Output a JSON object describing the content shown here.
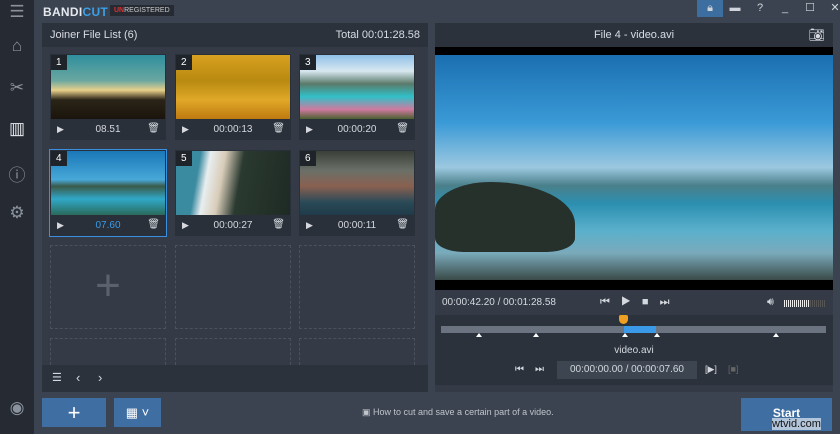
{
  "app": {
    "logo_main": "BANDI",
    "logo_accent": "CUT",
    "unreg_red": "UN",
    "unreg_rest": "REGISTERED",
    "watermark": "wtvid.com"
  },
  "sidebar": {
    "items": [
      "menu",
      "home",
      "cut",
      "joiner",
      "info",
      "settings",
      "record"
    ]
  },
  "joiner": {
    "title": "Joiner File List (6)",
    "total": "Total 00:01:28.58",
    "files": [
      {
        "num": "1",
        "duration": "08.51"
      },
      {
        "num": "2",
        "duration": "00:00:13"
      },
      {
        "num": "3",
        "duration": "00:00:20"
      },
      {
        "num": "4",
        "duration": "07.60",
        "selected": true
      },
      {
        "num": "5",
        "duration": "00:00:27"
      },
      {
        "num": "6",
        "duration": "00:00:11"
      }
    ]
  },
  "player": {
    "title": "File 4 - video.avi",
    "time": "00:00:42.20 / 00:01:28.58",
    "clip_name": "video.avi",
    "clip_time": "00:00:00.00 / 00:00:07.60",
    "volume": 0.6,
    "playhead_fraction": 0.478
  },
  "bottom": {
    "tip": "How to cut and save a certain part of a video.",
    "start_label": "Start"
  },
  "colors": {
    "accent": "#3a8fe0",
    "start": "#3f6ea3",
    "playhead": "#f0a020"
  }
}
